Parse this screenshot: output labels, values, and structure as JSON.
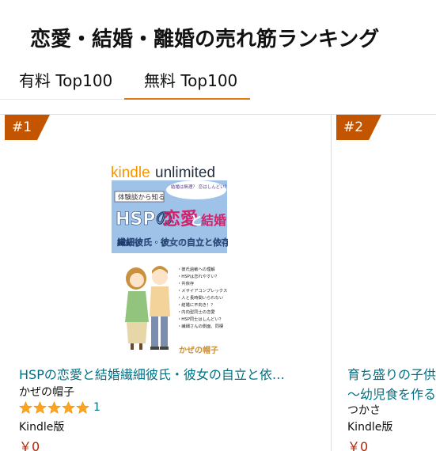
{
  "page": {
    "title": "恋愛・結婚・離婚の売れ筋ランキング"
  },
  "tabs": [
    {
      "label": "有料 Top100",
      "selected": false
    },
    {
      "label": "無料 Top100",
      "selected": true
    }
  ],
  "colors": {
    "accent_orange": "#e47911",
    "rank_badge": "#c45500",
    "link_teal": "#007185",
    "price_red": "#b12704",
    "star_orange": "#ffa41c"
  },
  "items": [
    {
      "rank": "#1",
      "cover": {
        "brand": "kindleunlimited",
        "bubble": "結婚は無理？ 恋はしんどい？ 諦める必要ありません！",
        "tagline": "体験談から知る",
        "headline_a": "HSPの",
        "headline_b": "恋愛",
        "headline_c": "と",
        "headline_d": "結婚",
        "subline": "繊細彼氏・彼女の自立と依存",
        "bullets": [
          "・彼氏過敏への理解",
          "・HSPは恋れやすい？",
          "・共依存",
          "・メサイアコンプレックス",
          "・人と長時間いられない",
          "・結婚に不向き！？",
          "・内向型同士の恋愛",
          "・HSP同士はしんどい？",
          "・繊細さんの側面、同棲"
        ],
        "author_mark": "かぜの帽子"
      },
      "title": "HSPの恋愛と結婚繊細彼氏・彼女の自立と依…",
      "author": "かぜの帽子",
      "stars": 5,
      "rating_count": "1",
      "format": "Kindle版",
      "price": "￥0"
    },
    {
      "rank": "#2",
      "title": "育ち盛りの子供",
      "subtitle": "～幼児食を作る",
      "author": "つかさ",
      "format": "Kindle版",
      "price": "￥0"
    }
  ]
}
